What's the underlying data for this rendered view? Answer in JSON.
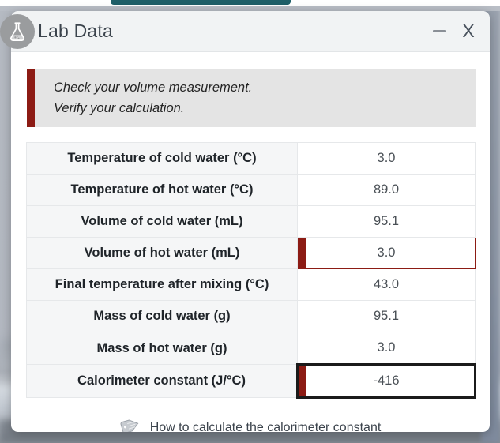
{
  "window": {
    "title": "Lab Data",
    "icon": "flask-icon",
    "minimize_label": "—",
    "close_label": "X"
  },
  "alert": {
    "accent_color": "#8c1b14",
    "lines": [
      "Check your volume measurement.",
      "Verify your calculation."
    ]
  },
  "table": {
    "rows": [
      {
        "label": "Temperature of cold water (°C)",
        "value": "3.0",
        "state": "normal"
      },
      {
        "label": "Temperature of hot water (°C)",
        "value": "89.0",
        "state": "normal"
      },
      {
        "label": "Volume of cold water (mL)",
        "value": "95.1",
        "state": "normal"
      },
      {
        "label": "Volume of hot water (mL)",
        "value": "3.0",
        "state": "flagged"
      },
      {
        "label": "Final temperature after mixing (°C)",
        "value": "43.0",
        "state": "normal"
      },
      {
        "label": "Mass of cold water (g)",
        "value": "95.1",
        "state": "normal"
      },
      {
        "label": "Mass of hot water (g)",
        "value": "3.0",
        "state": "normal"
      },
      {
        "label": "Calorimeter constant (J/°C)",
        "value": "-416",
        "state": "focused"
      }
    ]
  },
  "footer": {
    "icon": "tag-icon",
    "link_text": "How to calculate the calorimeter constant"
  },
  "chrome": {
    "tab_accent_color": "#1f5f68"
  }
}
